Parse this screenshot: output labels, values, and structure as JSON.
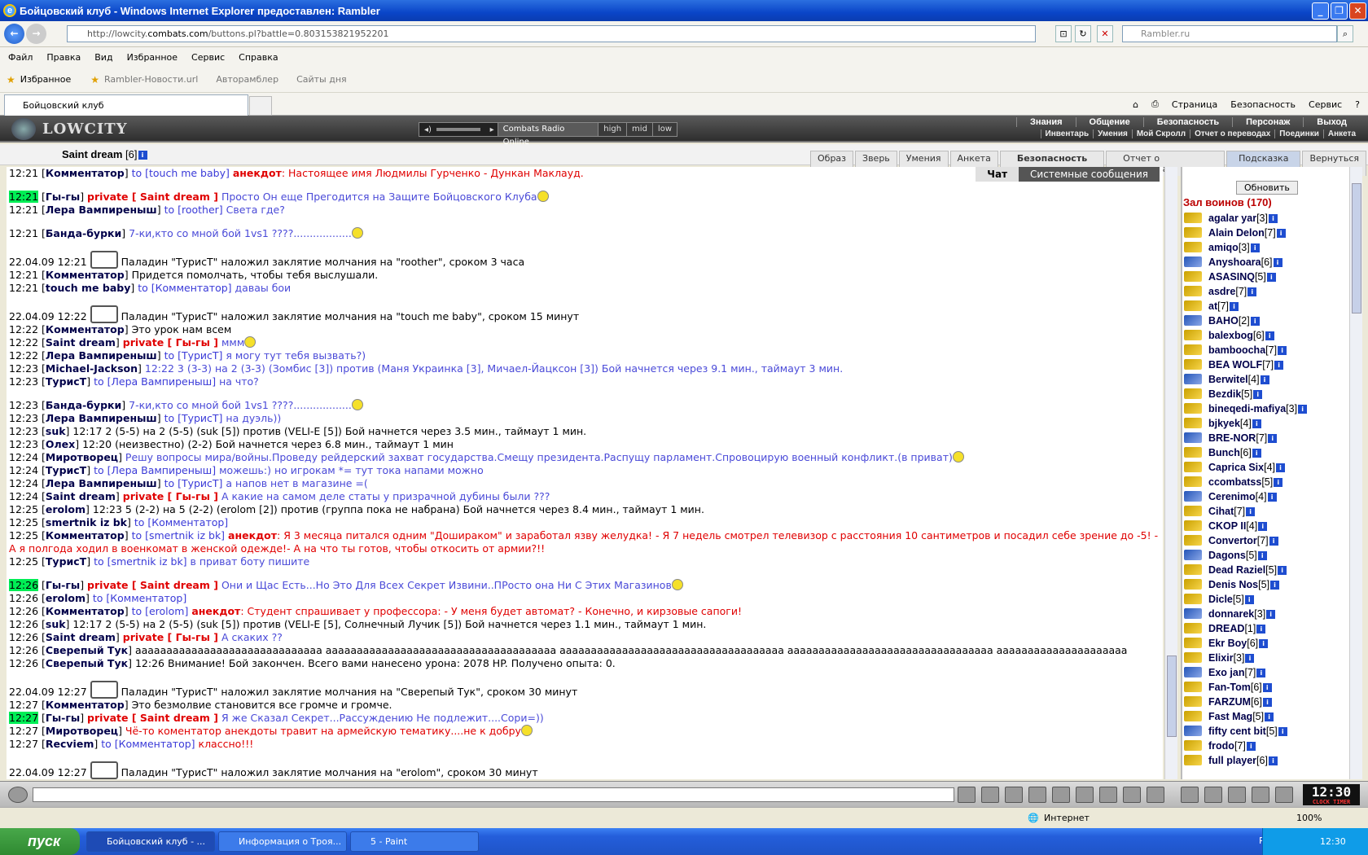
{
  "window": {
    "title": "Бойцовский клуб - Windows Internet Explorer предоставлен: Rambler"
  },
  "address": {
    "url_prefix": "http://lowcity.",
    "url_domain": "combats.com",
    "url_suffix": "/buttons.pl?battle=0.803153821952201",
    "search_placeholder": "Rambler.ru"
  },
  "menu": [
    "Файл",
    "Правка",
    "Вид",
    "Избранное",
    "Сервис",
    "Справка"
  ],
  "favorites": {
    "label": "Избранное",
    "items": [
      "Rambler-Новости.url",
      "Авторамблер",
      "Сайты дня"
    ]
  },
  "tab": {
    "title": "Бойцовский клуб"
  },
  "commands": [
    "Страница",
    "Безопасность",
    "Сервис"
  ],
  "game": {
    "logo": "LOWCITY",
    "radio": {
      "name": "Combats Radio Online",
      "q1": "high",
      "q2": "mid",
      "q3": "low"
    },
    "menu1": [
      "Знания",
      "Общение",
      "Безопасность",
      "Персонаж",
      "Выход"
    ],
    "menu2": [
      "Инвентарь",
      "Умения",
      "Мой Скролл",
      "Отчет о переводах",
      "Поединки",
      "Анкета"
    ],
    "player": {
      "name": "Saint dream",
      "level": "[6]"
    },
    "tabs": [
      "Образ",
      "Зверь",
      "Умения",
      "Анкета",
      "Безопасность",
      "Отчет о переводах",
      "Подсказка",
      "Вернуться"
    ],
    "chat_tabs": {
      "chat": "Чат",
      "system": "Системные сообщения"
    },
    "refresh": "Обновить",
    "hall_title": "Зал воинов (170)",
    "clock": "12:30",
    "clock_sub": "CLOCK TIMER"
  },
  "players": [
    [
      "agalar yar",
      "[3]"
    ],
    [
      "Alain Delon",
      "[7]"
    ],
    [
      "amiqo",
      "[3]"
    ],
    [
      "Anyshoara",
      "[6]"
    ],
    [
      "ASASINQ",
      "[5]"
    ],
    [
      "asdre",
      "[7]"
    ],
    [
      "at",
      "[7]"
    ],
    [
      "BAHO",
      "[2]"
    ],
    [
      "balexbog",
      "[6]"
    ],
    [
      "bamboocha",
      "[7]"
    ],
    [
      "BEA WOLF",
      "[7]"
    ],
    [
      "Berwitel",
      "[4]"
    ],
    [
      "Bezdik",
      "[5]"
    ],
    [
      "bineqedi-mafiya",
      "[3]"
    ],
    [
      "bjkyek",
      "[4]"
    ],
    [
      "BRE-NOR",
      "[7]"
    ],
    [
      "Bunch",
      "[6]"
    ],
    [
      "Caprica Six",
      "[4]"
    ],
    [
      "ccombatss",
      "[5]"
    ],
    [
      "Cerenimo",
      "[4]"
    ],
    [
      "Cihat",
      "[7]"
    ],
    [
      "CKOP II",
      "[4]"
    ],
    [
      "Convertor",
      "[7]"
    ],
    [
      "Dagons",
      "[5]"
    ],
    [
      "Dead Raziel",
      "[5]"
    ],
    [
      "Denis Nos",
      "[5]"
    ],
    [
      "Dicle",
      "[5]"
    ],
    [
      "donnarek",
      "[3]"
    ],
    [
      "DREAD",
      "[1]"
    ],
    [
      "Ekr Boy",
      "[6]"
    ],
    [
      "Elixir",
      "[3]"
    ],
    [
      "Exo jan",
      "[7]"
    ],
    [
      "Fan-Tom",
      "[6]"
    ],
    [
      "FARZUM",
      "[6]"
    ],
    [
      "Fast Mag",
      "[5]"
    ],
    [
      "fifty cent bit",
      "[5]"
    ],
    [
      "frodo",
      "[7]"
    ],
    [
      "full player",
      "[6]"
    ]
  ],
  "chat": [
    {
      "t": "12:21",
      "n": "Комментатор",
      "to": "to [touch me baby]",
      "an": "анекдот",
      "m": ": Настоящее имя Людмилы Гурченко - Дункан Маклауд.",
      "cls": "red"
    },
    {
      "gap": true
    },
    {
      "t": "12:21",
      "hl": true,
      "n": "Гы-гы",
      "pv": "private [ Saint dream ]",
      "m": "Просто Он еще Прегодится на Защите Бойцовского Клуба",
      "cls": "msg",
      "sm": true
    },
    {
      "t": "12:21",
      "n": "Лера Вампиреныш",
      "to": "to [roother]",
      "m": "Света где?",
      "cls": "msg"
    },
    {
      "gap": true
    },
    {
      "t": "12:21",
      "n": "Банда-бурки",
      "m": "7-ки,кто со мной бой 1vs1 ????..................",
      "cls": "msg",
      "sm": true
    },
    {
      "gap": true
    },
    {
      "t": "22.04.09 12:21",
      "scroll": true,
      "m": "Паладин \"ТурисТ\" наложил заклятие молчания на \"roother\", сроком 3 часа",
      "cls": ""
    },
    {
      "t": "12:21",
      "n": "Комментатор",
      "m": "Придется помолчать, чтобы тебя выслушали.",
      "cls": ""
    },
    {
      "t": "12:21",
      "n": "touch me baby",
      "to": "to [Комментатор]",
      "m": "даваы бои",
      "cls": "msg"
    },
    {
      "gap": true
    },
    {
      "t": "22.04.09 12:22",
      "scroll": true,
      "m": "Паладин \"ТурисТ\" наложил заклятие молчания на \"touch me baby\", сроком 15 минут",
      "cls": ""
    },
    {
      "t": "12:22",
      "n": "Комментатор",
      "m": "Это урок нам всем",
      "cls": ""
    },
    {
      "t": "12:22",
      "n": "Saint dream",
      "pv": "private [ Гы-гы ]",
      "m": "ммм",
      "cls": "msg",
      "sm": true
    },
    {
      "t": "12:22",
      "n": "Лера Вампиреныш",
      "to": "to [ТурисТ]",
      "m": "я могу тут тебя вызвать?)",
      "cls": "msg"
    },
    {
      "t": "12:23",
      "n": "Michael-Jackson",
      "m": "12:22 3 (3-3) на 2 (3-3) (Зомбис [3]) против (Маня Украинка [3], Мичаел-Йацксон [3]) Бой начнется через 9.1 мин., таймаут 3 мин.",
      "cls": "msg"
    },
    {
      "t": "12:23",
      "n": "ТурисТ",
      "to": "to [Лера Вампиреныш]",
      "m": "на что?",
      "cls": "msg"
    },
    {
      "gap": true
    },
    {
      "t": "12:23",
      "n": "Банда-бурки",
      "m": "7-ки,кто со мной бой 1vs1 ????..................",
      "cls": "msg",
      "sm": true
    },
    {
      "t": "12:23",
      "n": "Лера Вампиреныш",
      "to": "to [ТурисТ]",
      "m": "на дуэль))",
      "cls": "msg"
    },
    {
      "t": "12:23",
      "n": "suk",
      "m": "12:17 2 (5-5) на 2 (5-5) (suk [5]) против (VELI-E [5]) Бой начнется через 3.5 мин., таймаут 1 мин.",
      "cls": ""
    },
    {
      "t": "12:23",
      "n": "Олех",
      "m": "12:20 (неизвестно) (2-2) Бой начнется через 6.8 мин., таймаут 1 мин",
      "cls": ""
    },
    {
      "t": "12:24",
      "n": "Миротворец",
      "m": "Решу вопросы мира/войны.Проведу рейдерский захват государства.Смещу президента.Распущу парламент.Спровоцирую военный конфликт.(в приват)",
      "cls": "msg",
      "sm": true
    },
    {
      "t": "12:24",
      "n": "ТурисТ",
      "to": "to [Лера Вампиреныш]",
      "m": "можешь:) но игрокам *= тут тока напами можно",
      "cls": "msg"
    },
    {
      "t": "12:24",
      "n": "Лера Вампиреныш",
      "to": "to [ТурисТ]",
      "m": "а напов нет в магазине =(",
      "cls": "msg"
    },
    {
      "t": "12:24",
      "n": "Saint dream",
      "pv": "private [ Гы-гы ]",
      "m": "А какие на самом деле статы у призрачной дубины были ???",
      "cls": "msg"
    },
    {
      "t": "12:25",
      "n": "erolom",
      "m": "12:23 5 (2-2) на 5 (2-2) (erolom [2]) против (группа пока не набрана) Бой начнется через 8.4 мин., таймаут 1 мин.",
      "cls": ""
    },
    {
      "t": "12:25",
      "n": "smertnik iz bk",
      "to": "to [Комментатор]",
      "m": "",
      "cls": "msg"
    },
    {
      "t": "12:25",
      "n": "Комментатор",
      "to": "to [smertnik iz bk]",
      "an": "анекдот",
      "m": ": Я 3 месяца питался одним \"Дошираком\" и заработал язву желудка! - Я 7 недель смотрел телевизор с расстояния 10 сантиметров и посадил себе зрение до -5! - А я полгода ходил в военкомат в женской одежде!- А на что ты готов, чтобы откосить от армии?!!",
      "cls": "red",
      "wrap": true
    },
    {
      "t": "12:25",
      "n": "ТурисТ",
      "to": "to [smertnik iz bk]",
      "m": "в приват боту пишите",
      "cls": "msg"
    },
    {
      "gap": true
    },
    {
      "t": "12:26",
      "hl": true,
      "n": "Гы-гы",
      "pv": "private [ Saint dream ]",
      "m": "Они и Щас Есть...Но Это Для Всех Секрет Извини..ПРосто она Ни С Этих Магазинов",
      "cls": "msg",
      "sm": true
    },
    {
      "t": "12:26",
      "n": "erolom",
      "to": "to [Комментатор]",
      "m": "",
      "cls": ""
    },
    {
      "t": "12:26",
      "n": "Комментатор",
      "to": "to [erolom]",
      "an": "анекдот",
      "m": ": Студент спрашивает у профессора: - У меня будет автомат? - Конечно, и кирзовые сапоги!",
      "cls": "red"
    },
    {
      "t": "12:26",
      "n": "suk",
      "m": "12:17 2 (5-5) на 2 (5-5) (suk [5]) против (VELI-E [5], Солнечный Лучик [5]) Бой начнется через 1.1 мин., таймаут 1 мин.",
      "cls": ""
    },
    {
      "t": "12:26",
      "n": "Saint dream",
      "pv": "private [ Гы-гы ]",
      "m": "А скаких ??",
      "cls": "msg"
    },
    {
      "t": "12:26",
      "n": "Сверепый Тук",
      "m": "аааааааааааааааааааааааааааааа ааааааааааааааааааааааааааааааааааааа аааааааааааааааааааааааааааааааааааа ааааааааааааааааааааааааааааааааа ааааааааааааааааааааа",
      "cls": ""
    },
    {
      "t": "12:26",
      "n": "Сверепый Тук",
      "m": "12:26 Внимание! Бой закончен. Всего вами нанесено урона: 2078 HP. Получено опыта: 0.",
      "cls": ""
    },
    {
      "gap": true
    },
    {
      "t": "22.04.09 12:27",
      "scroll": true,
      "m": "Паладин \"ТурисТ\" наложил заклятие молчания на \"Сверепый Тук\", сроком 30 минут",
      "cls": ""
    },
    {
      "t": "12:27",
      "n": "Комментатор",
      "m": "Это безмолвие становится все громче и громче.",
      "cls": ""
    },
    {
      "t": "12:27",
      "hl": true,
      "n": "Гы-гы",
      "pv": "private [ Saint dream ]",
      "m": "Я же Сказал Секрет...Рассуждению Не подлежит....Сори=))",
      "cls": "msg"
    },
    {
      "t": "12:27",
      "n": "Миротворец",
      "m": "Чё-то коментатор анекдоты травит на армейскую тематику....не к добру",
      "cls": "red",
      "sm": true
    },
    {
      "t": "12:27",
      "n": "Recviem",
      "to": "to [Комментатор]",
      "m": "классно!!!",
      "cls": "red"
    },
    {
      "gap": true
    },
    {
      "t": "22.04.09 12:27",
      "scroll": true,
      "m": "Паладин \"ТурисТ\" наложил заклятие молчания на \"erolom\", сроком 30 минут",
      "cls": ""
    }
  ],
  "status": {
    "zone": "Интернет",
    "zoom": "100%"
  },
  "taskbar": {
    "start": "пуск",
    "tasks": [
      "Бойцовский клуб - ...",
      "Информация о Троя...",
      "5 - Paint"
    ],
    "lang": "RU",
    "time": "12:30"
  }
}
